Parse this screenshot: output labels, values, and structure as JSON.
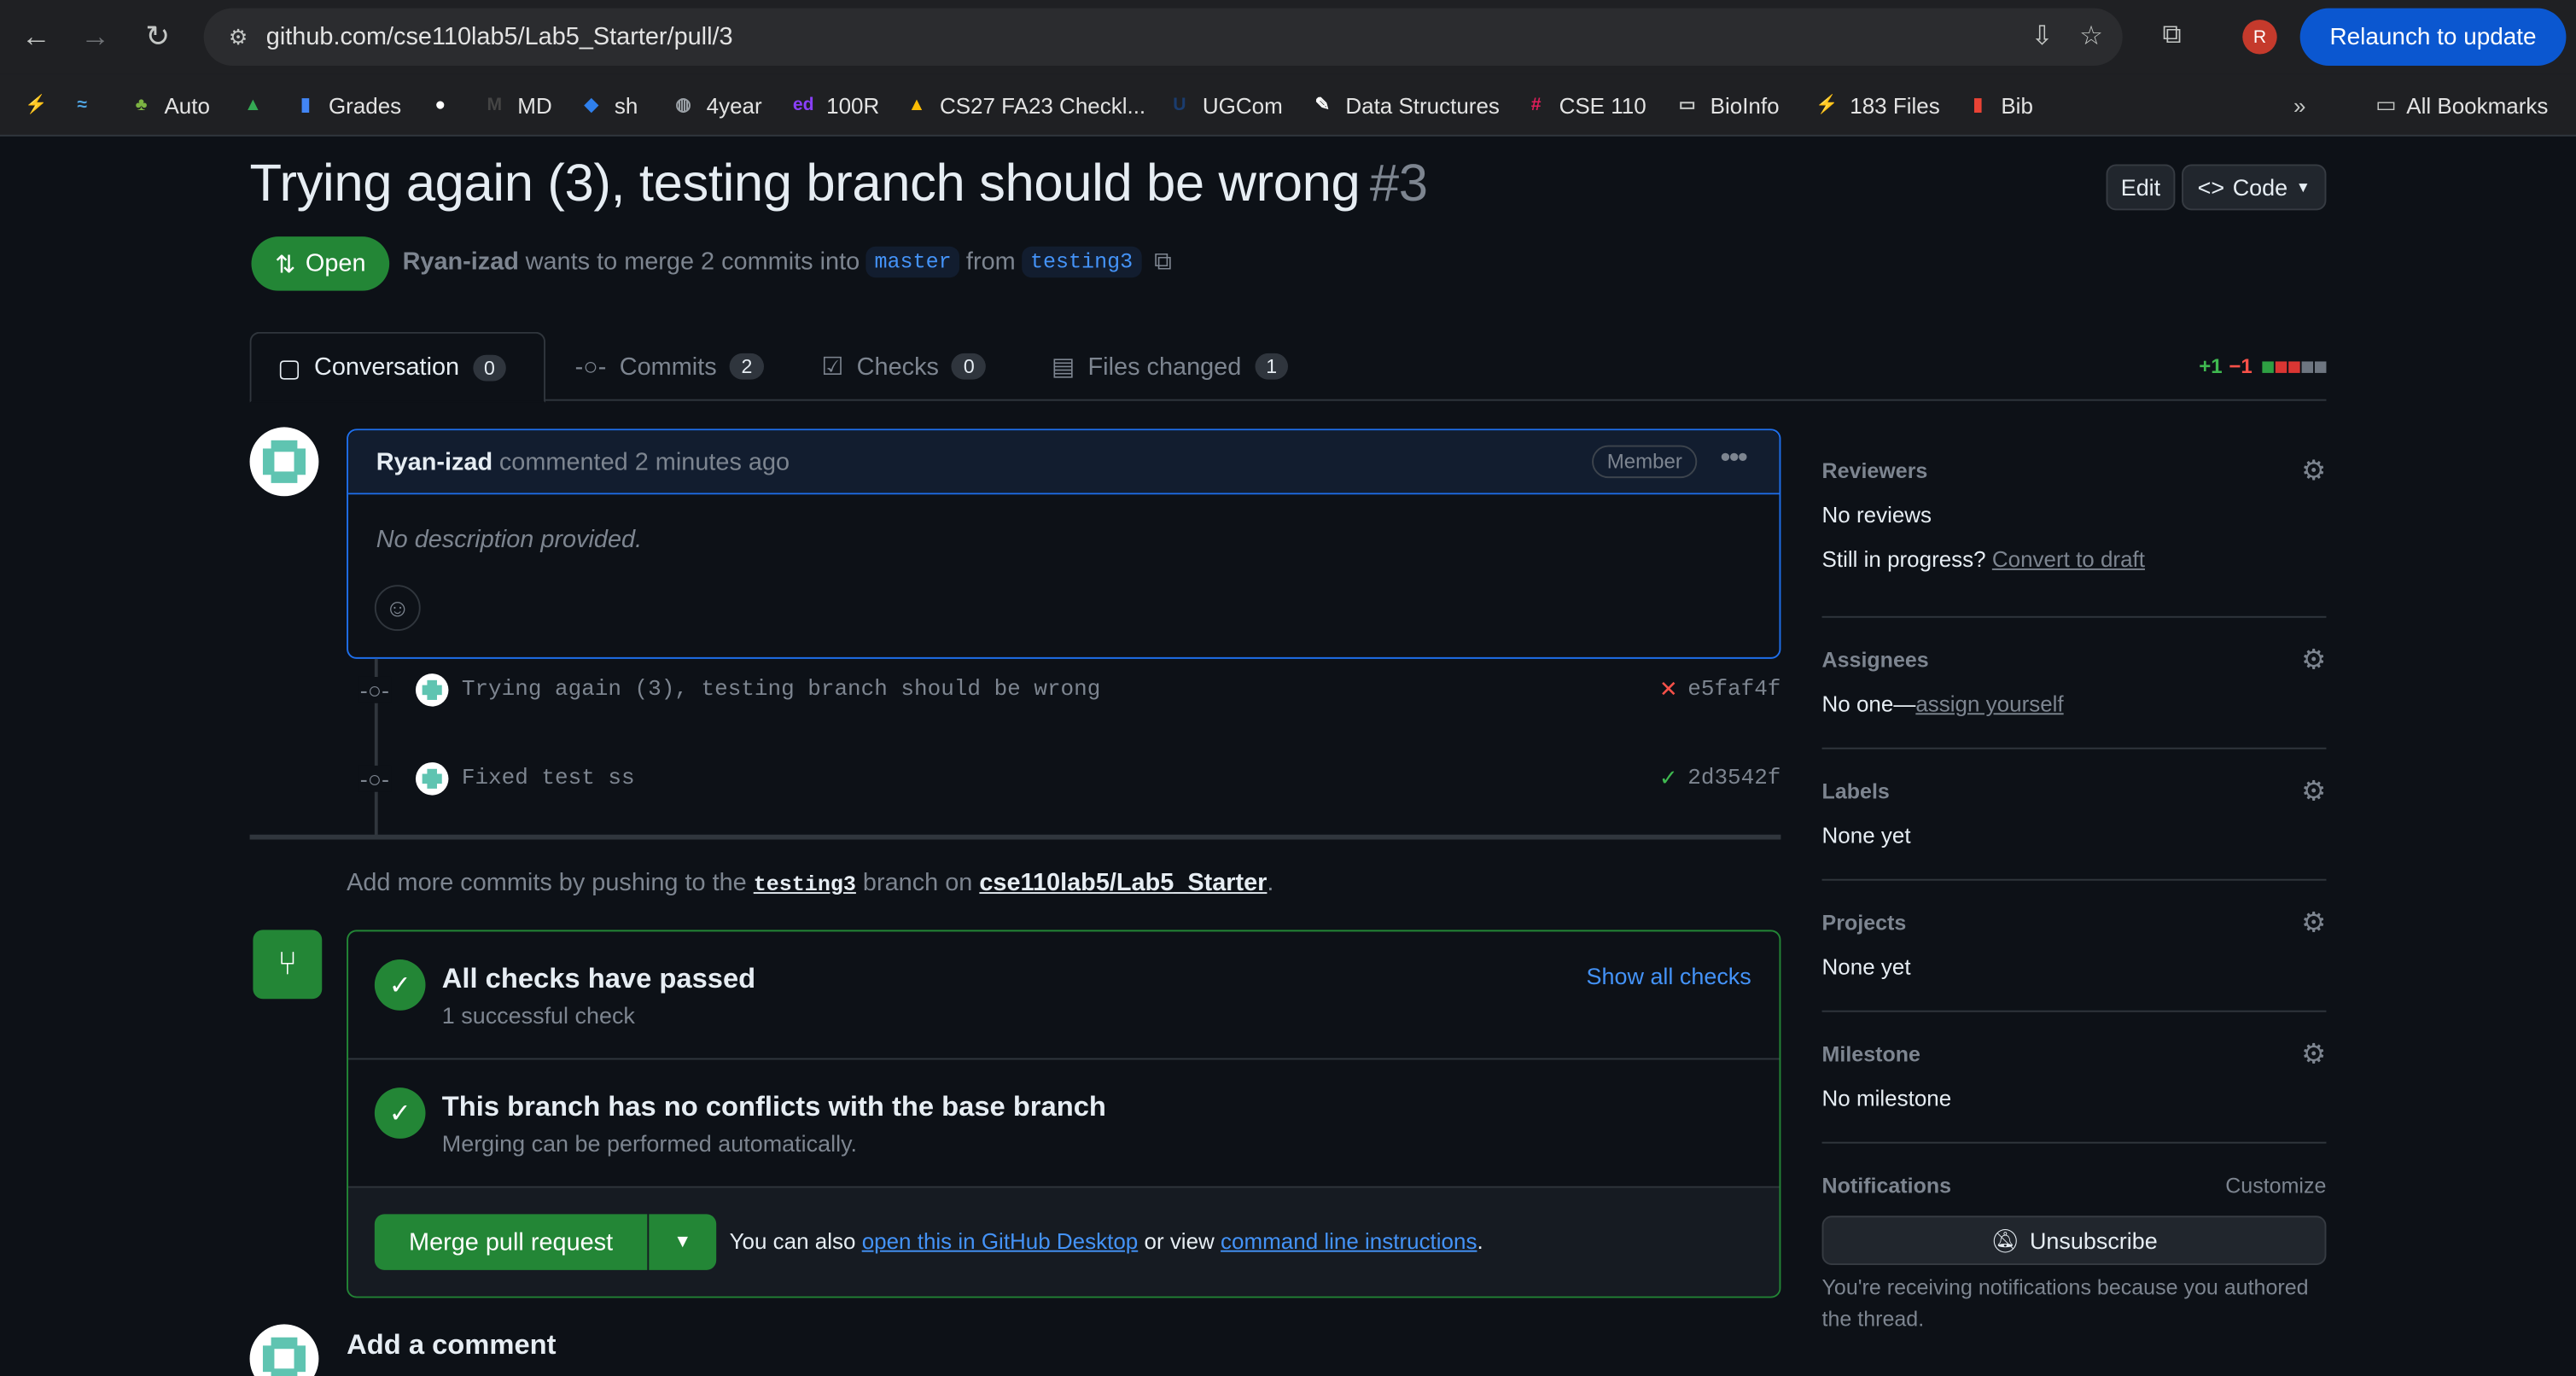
{
  "browser": {
    "url": "github.com/cse110lab5/Lab5_Starter/pull/3",
    "relaunch_label": "Relaunch to update",
    "profile_initial": "R",
    "bookmarks": [
      {
        "label": "",
        "icon": "bolt-icon",
        "color": "#f5c518"
      },
      {
        "label": "",
        "icon": "fish-icon",
        "color": "#4fa3e0"
      },
      {
        "label": "Auto",
        "icon": "auto-icon",
        "color": "#7cb342"
      },
      {
        "label": "",
        "icon": "drive-icon",
        "color": "#34a853"
      },
      {
        "label": "Grades",
        "icon": "bar-chart-icon",
        "color": "#4285f4"
      },
      {
        "label": "",
        "icon": "github-icon",
        "color": "#ffffff"
      },
      {
        "label": "MD",
        "icon": "markdown-icon",
        "color": "#444444"
      },
      {
        "label": "sh",
        "icon": "vscode-icon",
        "color": "#2f80ed"
      },
      {
        "label": "4year",
        "icon": "globe-icon",
        "color": "#9aa0a6"
      },
      {
        "label": "100R",
        "icon": "ed-icon",
        "color": "#8a3ffc"
      },
      {
        "label": "CS27 FA23 Checkl...",
        "icon": "drive-icon",
        "color": "#fbbc04"
      },
      {
        "label": "UGCom",
        "icon": "ucsd-icon",
        "color": "#1a3c6e"
      },
      {
        "label": "Data Structures",
        "icon": "quill-icon",
        "color": "#ffffff"
      },
      {
        "label": "CSE 110",
        "icon": "slack-icon",
        "color": "#e01e5a"
      },
      {
        "label": "BioInfo",
        "icon": "folder-icon",
        "color": "#c4c7c5"
      },
      {
        "label": "183 Files",
        "icon": "bolt-icon",
        "color": "#f5c518"
      },
      {
        "label": "Bib",
        "icon": "bookmark-icon",
        "color": "#ea4335"
      }
    ],
    "all_bookmarks": "All Bookmarks"
  },
  "pr": {
    "title": "Trying again (3), testing branch should be wrong",
    "number": "#3",
    "edit_label": "Edit",
    "code_label": "Code",
    "state": "Open",
    "author": "Ryan-izad",
    "merge_text": "wants to merge 2 commits into",
    "base": "master",
    "from_text": "from",
    "head": "testing3"
  },
  "tabs": [
    {
      "label": "Conversation",
      "count": "0",
      "icon": "comment-icon"
    },
    {
      "label": "Commits",
      "count": "2",
      "icon": "commit-icon"
    },
    {
      "label": "Checks",
      "count": "0",
      "icon": "checklist-icon"
    },
    {
      "label": "Files changed",
      "count": "1",
      "icon": "file-diff-icon"
    }
  ],
  "diffstat": {
    "add": "+1",
    "del": "−1",
    "colors": [
      "#2ea043",
      "#da3633",
      "#da3633",
      "#6e7681",
      "#6e7681"
    ]
  },
  "comment": {
    "author": "Ryan-izad",
    "action": "commented 2 minutes ago",
    "badge": "Member",
    "body": "No description provided."
  },
  "commits": [
    {
      "message": "Trying again (3), testing branch should be wrong",
      "status": "✕",
      "status_color": "#f85149",
      "sha": "e5faf4f"
    },
    {
      "message": "Fixed test ss",
      "status": "✓",
      "status_color": "#3fb950",
      "sha": "2d3542f"
    }
  ],
  "push_note": {
    "before": "Add more commits by pushing to the",
    "branch": "testing3",
    "middle": "branch on",
    "repo": "cse110lab5/Lab5_Starter",
    "end": "."
  },
  "merge": {
    "checks_title": "All checks have passed",
    "checks_sub": "1 successful check",
    "show_all": "Show all checks",
    "conflict_title": "This branch has no conflicts with the base branch",
    "conflict_sub": "Merging can be performed automatically.",
    "merge_button": "Merge pull request",
    "also_1": "You can also",
    "desktop_link": "open this in GitHub Desktop",
    "also_2": "or view",
    "cli_link": "command line instructions",
    "also_3": "."
  },
  "add_comment": "Add a comment",
  "sidebar": {
    "reviewers": {
      "title": "Reviewers",
      "value": "No reviews",
      "progress": "Still in progress?",
      "draft_link": "Convert to draft"
    },
    "assignees": {
      "title": "Assignees",
      "value": "No one—",
      "link": "assign yourself"
    },
    "labels": {
      "title": "Labels",
      "value": "None yet"
    },
    "projects": {
      "title": "Projects",
      "value": "None yet"
    },
    "milestone": {
      "title": "Milestone",
      "value": "No milestone"
    },
    "notifications": {
      "title": "Notifications",
      "customize": "Customize",
      "button": "Unsubscribe",
      "reason": "You're receiving notifications because you authored the thread."
    }
  }
}
